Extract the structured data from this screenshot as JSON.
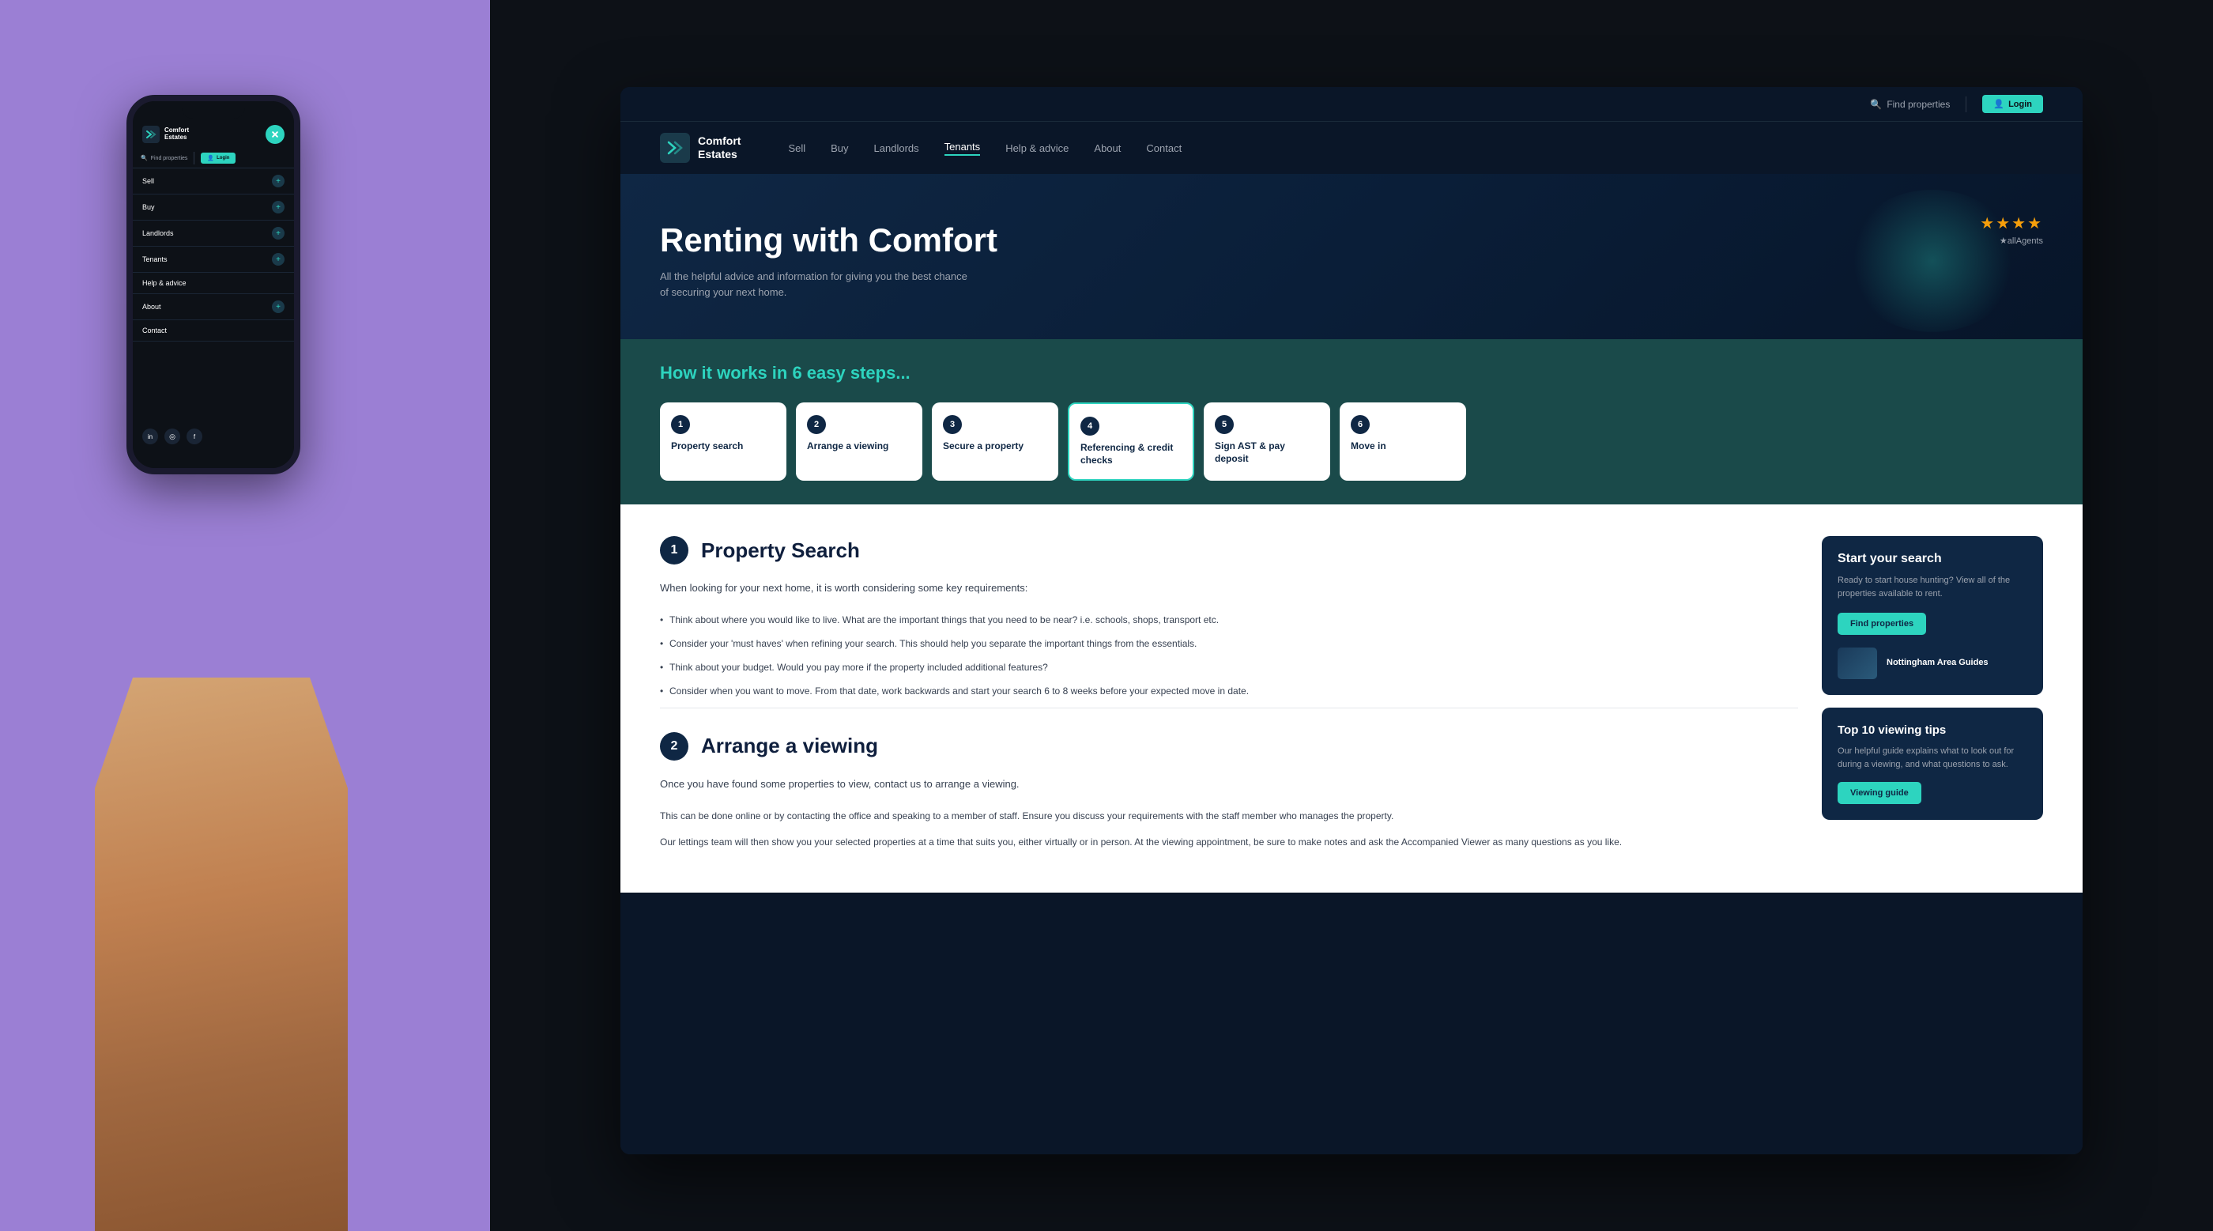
{
  "left_panel": {
    "background_color": "#9b7fd4"
  },
  "phone": {
    "logo_name": "Comfort",
    "logo_subname": "Estates",
    "close_btn_label": "×",
    "nav_find_properties": "Find properties",
    "nav_login": "Login",
    "menu_items": [
      {
        "label": "Sell",
        "has_plus": true
      },
      {
        "label": "Buy",
        "has_plus": true
      },
      {
        "label": "Landlords",
        "has_plus": true
      },
      {
        "label": "Tenants",
        "has_plus": true
      },
      {
        "label": "Help & advice",
        "has_plus": false
      },
      {
        "label": "About",
        "has_plus": false
      },
      {
        "label": "Contact",
        "has_plus": false
      }
    ],
    "social_icons": [
      "in",
      "○",
      "f"
    ]
  },
  "browser": {
    "utility_bar": {
      "find_properties": "Find properties",
      "login_label": "Login"
    },
    "nav": {
      "logo_name": "Comfort",
      "logo_subname": "Estates",
      "links": [
        {
          "label": "Sell",
          "active": false
        },
        {
          "label": "Buy",
          "active": false
        },
        {
          "label": "Landlords",
          "active": false
        },
        {
          "label": "Tenants",
          "active": true
        },
        {
          "label": "Help & advice",
          "active": false
        },
        {
          "label": "About",
          "active": false
        },
        {
          "label": "Contact",
          "active": false
        }
      ]
    },
    "hero": {
      "title": "Renting with Comfort",
      "subtitle": "All the helpful advice and information for giving you the best chance of securing your next home.",
      "allagents_stars": "★★★★",
      "allagents_text": "★allAgents"
    },
    "steps_section": {
      "title": "How it works in 6 easy steps...",
      "steps": [
        {
          "number": "1",
          "label": "Property search"
        },
        {
          "number": "2",
          "label": "Arrange a viewing"
        },
        {
          "number": "3",
          "label": "Secure a property"
        },
        {
          "number": "4",
          "label": "Referencing & credit checks"
        },
        {
          "number": "5",
          "label": "Sign AST & pay deposit"
        },
        {
          "number": "6",
          "label": "Move in"
        }
      ]
    },
    "section1": {
      "number": "1",
      "title": "Property Search",
      "description": "When looking for your next home, it is worth considering some key requirements:",
      "bullets": [
        "Think about where you would like to live. What are the important things that you need to be near? i.e. schools, shops, transport etc.",
        "Consider your 'must haves' when refining your search. This should help you separate the important things from the essentials.",
        "Think about your budget. Would you pay more if the property included additional features?",
        "Consider when you want to move. From that date, work backwards and start your search 6 to 8 weeks before your expected move in date."
      ]
    },
    "section2": {
      "number": "2",
      "title": "Arrange a viewing",
      "description": "Once you have found some properties to view, contact us to arrange a viewing.",
      "body_text1": "This can be done online or by contacting the office and speaking to a member of staff. Ensure you discuss your requirements with the staff member who manages the property.",
      "body_text2": "Our lettings team will then show you your selected properties at a time that suits you, either virtually or in person. At the viewing appointment, be sure to make notes and ask the Accompanied Viewer as many questions as you like."
    },
    "sidebar": {
      "card1": {
        "title": "Start your search",
        "text": "Ready to start house hunting? View all of the properties available to rent.",
        "btn_label": "Find properties",
        "guide_label": "Nottingham Area Guides"
      },
      "card2": {
        "title": "Top 10 viewing tips",
        "text": "Our helpful guide explains what to look out for during a viewing, and what questions to ask.",
        "btn_label": "Viewing guide"
      }
    }
  }
}
